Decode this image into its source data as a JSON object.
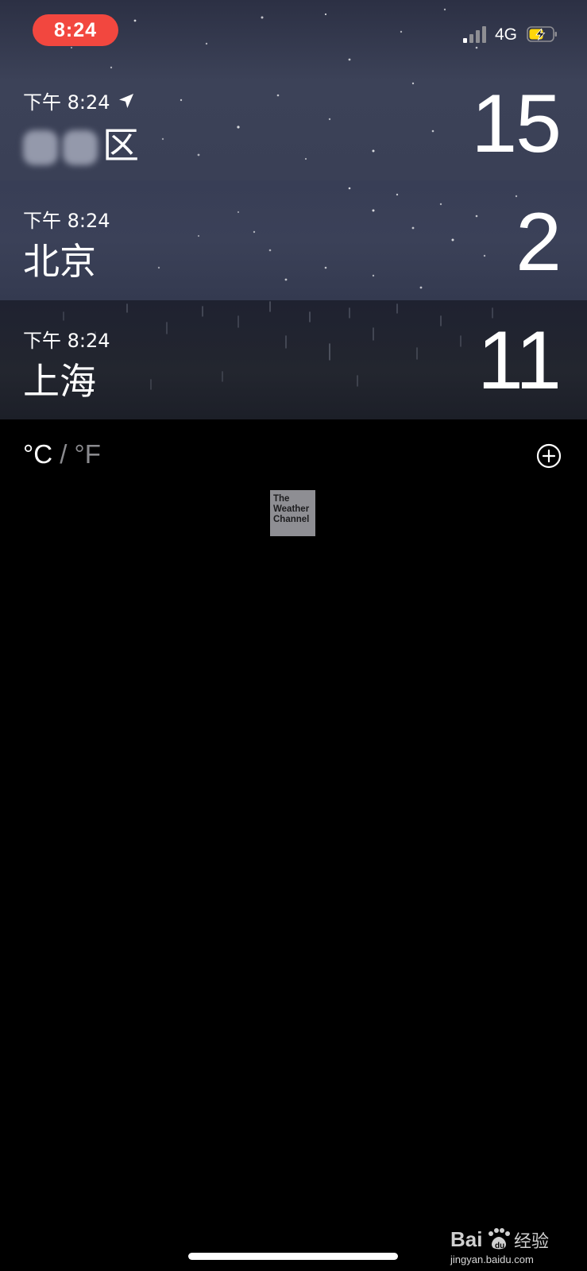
{
  "status_bar": {
    "time": "8:24",
    "network": "4G",
    "signal_bars_on": 1,
    "signal_bars_total": 4,
    "battery_color": "#ffd60a",
    "time_pill_color": "#f2473f"
  },
  "cities": [
    {
      "local_time": "下午 8:24",
      "name": "区",
      "temperature": "15",
      "current_location": true
    },
    {
      "local_time": "下午 8:24",
      "name": "北京",
      "temperature": "2",
      "current_location": false
    },
    {
      "local_time": "下午 8:24",
      "name": "上海",
      "temperature": "11",
      "current_location": false
    }
  ],
  "units": {
    "celsius": "°C",
    "separator": "/",
    "fahrenheit": "°F",
    "selected": "celsius"
  },
  "provider": {
    "line1": "The",
    "line2": "Weather",
    "line3": "Channel"
  },
  "watermark": {
    "text": "jingyan.baidu.com"
  }
}
